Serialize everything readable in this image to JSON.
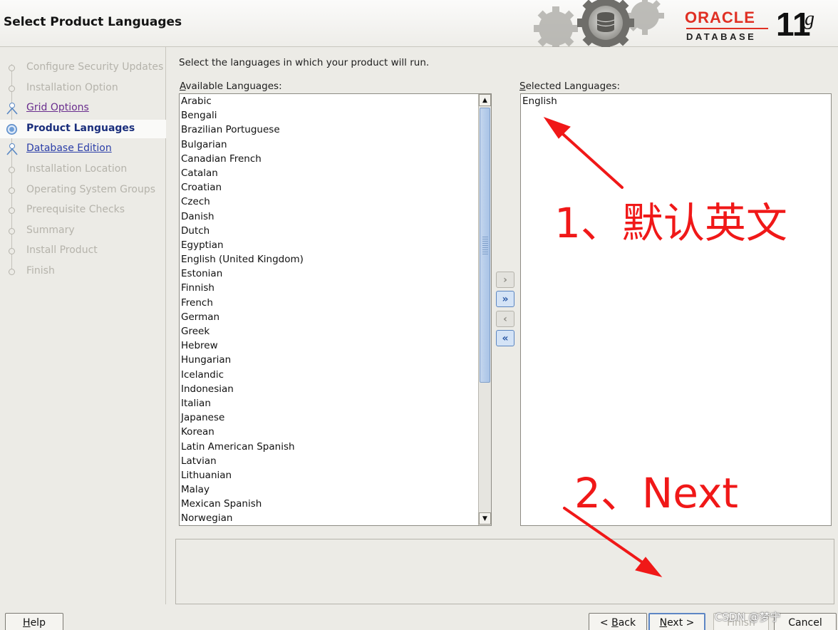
{
  "header": {
    "title": "Select Product Languages"
  },
  "logo": {
    "oracle": "ORACLE",
    "database": "DATABASE",
    "version": "11",
    "version_suffix": "g"
  },
  "steps": [
    {
      "label": "Configure Security Updates",
      "state": "disabled"
    },
    {
      "label": "Installation Option",
      "state": "disabled"
    },
    {
      "label": "Grid Options",
      "state": "visited"
    },
    {
      "label": "Product Languages",
      "state": "current"
    },
    {
      "label": "Database Edition",
      "state": "visited"
    },
    {
      "label": "Installation Location",
      "state": "disabled"
    },
    {
      "label": "Operating System Groups",
      "state": "disabled"
    },
    {
      "label": "Prerequisite Checks",
      "state": "disabled"
    },
    {
      "label": "Summary",
      "state": "disabled"
    },
    {
      "label": "Install Product",
      "state": "disabled"
    },
    {
      "label": "Finish",
      "state": "disabled"
    }
  ],
  "main": {
    "instructions": "Select the languages in which your product will run.",
    "available_label": "Available Languages:",
    "available_label_mnemonic": "A",
    "available_label_rest": "vailable Languages:",
    "selected_label": "Selected Languages:",
    "selected_label_mnemonic": "S",
    "selected_label_rest": "elected Languages:",
    "available_languages": [
      "Arabic",
      "Bengali",
      "Brazilian Portuguese",
      "Bulgarian",
      "Canadian French",
      "Catalan",
      "Croatian",
      "Czech",
      "Danish",
      "Dutch",
      "Egyptian",
      "English (United Kingdom)",
      "Estonian",
      "Finnish",
      "French",
      "German",
      "Greek",
      "Hebrew",
      "Hungarian",
      "Icelandic",
      "Indonesian",
      "Italian",
      "Japanese",
      "Korean",
      "Latin American Spanish",
      "Latvian",
      "Lithuanian",
      "Malay",
      "Mexican Spanish",
      "Norwegian"
    ],
    "selected_languages": [
      "English"
    ],
    "move_buttons": {
      "add_one": "›",
      "add_all": "»",
      "remove_one": "‹",
      "remove_all": "«"
    }
  },
  "annotations": {
    "note1": "1、默认英文",
    "note2": "2、Next"
  },
  "buttons": {
    "help": "Help",
    "help_mnemonic": "H",
    "help_rest": "elp",
    "back_prefix": "< ",
    "back_mnemonic": "B",
    "back_rest": "ack",
    "next_mnemonic": "N",
    "next_rest": "ext",
    "next_suffix": " >",
    "finish": "Finish",
    "cancel": "Cancel"
  },
  "watermark": "CSDN @梦宁",
  "colors": {
    "annotation": "#f01818",
    "accent": "#2b3ea8",
    "oracle_red": "#e03024"
  }
}
